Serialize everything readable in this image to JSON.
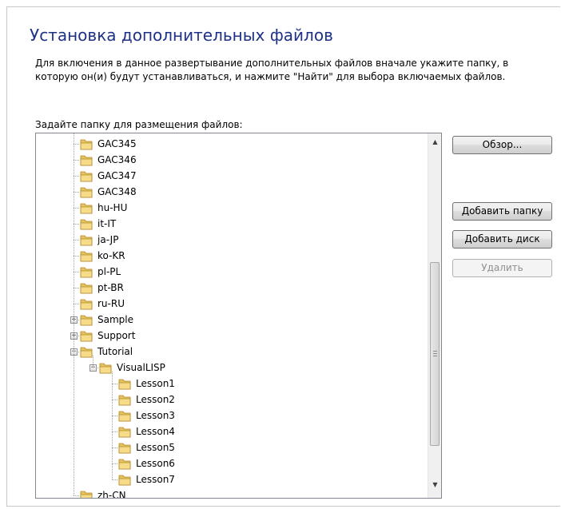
{
  "page": {
    "title": "Установка дополнительных файлов",
    "instructions": "Для включения в данное развертывание дополнительных файлов вначале укажите папку, в которую он(и) будут устанавливаться, и нажмите \"Найти\" для выбора включаемых файлов.",
    "folder_label": "Задайте папку для размещения файлов:"
  },
  "tree": {
    "nodes": [
      {
        "label": "GAC345",
        "depth": 0,
        "expander": ""
      },
      {
        "label": "GAC346",
        "depth": 0,
        "expander": ""
      },
      {
        "label": "GAC347",
        "depth": 0,
        "expander": ""
      },
      {
        "label": "GAC348",
        "depth": 0,
        "expander": ""
      },
      {
        "label": "hu-HU",
        "depth": 0,
        "expander": ""
      },
      {
        "label": "it-IT",
        "depth": 0,
        "expander": ""
      },
      {
        "label": "ja-JP",
        "depth": 0,
        "expander": ""
      },
      {
        "label": "ko-KR",
        "depth": 0,
        "expander": ""
      },
      {
        "label": "pl-PL",
        "depth": 0,
        "expander": ""
      },
      {
        "label": "pt-BR",
        "depth": 0,
        "expander": ""
      },
      {
        "label": "ru-RU",
        "depth": 0,
        "expander": ""
      },
      {
        "label": "Sample",
        "depth": 0,
        "expander": "+"
      },
      {
        "label": "Support",
        "depth": 0,
        "expander": "+"
      },
      {
        "label": "Tutorial",
        "depth": 0,
        "expander": "-"
      },
      {
        "label": "VisualLISP",
        "depth": 1,
        "expander": "-"
      },
      {
        "label": "Lesson1",
        "depth": 2,
        "expander": ""
      },
      {
        "label": "Lesson2",
        "depth": 2,
        "expander": ""
      },
      {
        "label": "Lesson3",
        "depth": 2,
        "expander": ""
      },
      {
        "label": "Lesson4",
        "depth": 2,
        "expander": ""
      },
      {
        "label": "Lesson5",
        "depth": 2,
        "expander": ""
      },
      {
        "label": "Lesson6",
        "depth": 2,
        "expander": ""
      },
      {
        "label": "Lesson7",
        "depth": 2,
        "expander": ""
      },
      {
        "label": "zh-CN",
        "depth": 0,
        "expander": ""
      }
    ],
    "scroll_arrow_up": "▲",
    "scroll_arrow_down": "▼",
    "scroll_position": 0.75
  },
  "buttons": {
    "browse": "Обзор...",
    "add_folder": "Добавить папку",
    "add_disk": "Добавить диск",
    "delete": "Удалить"
  },
  "icons": {
    "folder": "folder-icon",
    "expand": "plus-expander-icon",
    "collapse": "minus-expander-icon",
    "scroll_up": "scroll-up-arrow-icon",
    "scroll_down": "scroll-down-arrow-icon"
  },
  "colors": {
    "title": "#1e3287",
    "folder_body": "#e8c25a",
    "folder_front": "#f6dc8a",
    "disabled_text": "#8f8f8f"
  }
}
